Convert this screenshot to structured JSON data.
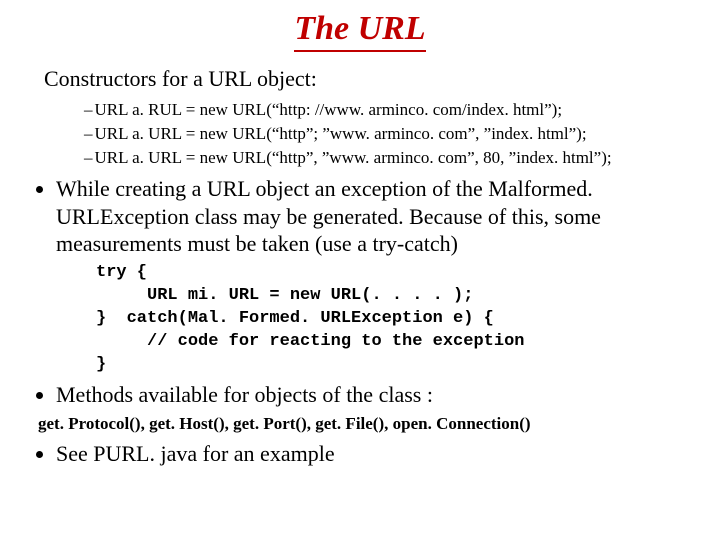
{
  "title": "The URL",
  "constructors_intro": "Constructors for a URL object:",
  "constructors": [
    "URL a. RUL = new URL(“http: //www. arminco. com/index. html”);",
    "URL a. URL = new URL(“http”; ”www. arminco. com”, ”index. html”);",
    "URL a. URL = new URL(“http”, ”www. arminco. com”, 80, ”index. html”);"
  ],
  "bullet1": "While creating a URL object an exception of the Malformed. URLException class may be generated.  Because of this, some measurements must be taken (use a try-catch)",
  "code": "try {\n     URL mi. URL = new URL(. . . . );\n}  catch(Mal. Formed. URLException e) {\n     // code for reacting to the exception\n}",
  "bullet2": "Methods available for objects of the class :",
  "methods_line": "get. Protocol(), get. Host(), get. Port(), get. File(), open. Connection()",
  "bullet3": "See PURL. java for an example"
}
